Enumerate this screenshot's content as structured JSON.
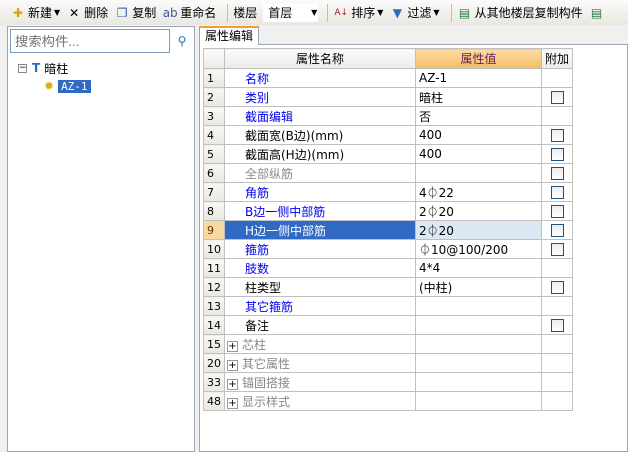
{
  "toolbar": {
    "new": "新建",
    "delete": "删除",
    "copy": "复制",
    "rename": "重命名",
    "floor_label": "楼层",
    "floor_value": "首层",
    "sort": "排序",
    "filter": "过滤",
    "copy_from_floor": "从其他楼层复制构件"
  },
  "left": {
    "search_placeholder": "搜索构件...",
    "tree_root": "暗柱",
    "tree_child": "AZ-1"
  },
  "tab": "属性编辑",
  "table": {
    "headers": [
      "属性名称",
      "属性值",
      "附加"
    ],
    "rows": [
      {
        "n": "1",
        "name": "名称",
        "value": "AZ-1",
        "color": "blue",
        "cb": false
      },
      {
        "n": "2",
        "name": "类别",
        "value": "暗柱",
        "color": "blue",
        "cb": true
      },
      {
        "n": "3",
        "name": "截面编辑",
        "value": "否",
        "color": "blue",
        "cb": false
      },
      {
        "n": "4",
        "name": "截面宽(B边)(mm)",
        "value": "400",
        "color": "black",
        "cb": true
      },
      {
        "n": "5",
        "name": "截面高(H边)(mm)",
        "value": "400",
        "color": "black",
        "cb": true
      },
      {
        "n": "6",
        "name": "全部纵筋",
        "value": "",
        "color": "gray",
        "cb": true
      },
      {
        "n": "7",
        "name": "角筋",
        "value": "4⏀22",
        "color": "blue",
        "cb": true
      },
      {
        "n": "8",
        "name": "B边一侧中部筋",
        "value": "2⏀20",
        "color": "blue",
        "cb": true
      },
      {
        "n": "9",
        "name": "H边一侧中部筋",
        "value": "2⏀20",
        "color": "blue",
        "cb": true,
        "selected": true
      },
      {
        "n": "10",
        "name": "箍筋",
        "value": "⏀10@100/200",
        "color": "blue",
        "cb": true
      },
      {
        "n": "11",
        "name": "肢数",
        "value": "4*4",
        "color": "blue",
        "cb": false
      },
      {
        "n": "12",
        "name": "柱类型",
        "value": "(中柱)",
        "color": "black",
        "cb": true
      },
      {
        "n": "13",
        "name": "其它箍筋",
        "value": "",
        "color": "blue",
        "cb": false
      },
      {
        "n": "14",
        "name": "备注",
        "value": "",
        "color": "black",
        "cb": true
      },
      {
        "n": "15",
        "name": "芯柱",
        "value": "",
        "color": "gray",
        "group": true
      },
      {
        "n": "20",
        "name": "其它属性",
        "value": "",
        "color": "gray",
        "group": true
      },
      {
        "n": "33",
        "name": "锚固搭接",
        "value": "",
        "color": "gray",
        "group": true
      },
      {
        "n": "48",
        "name": "显示样式",
        "value": "",
        "color": "gray",
        "group": true
      }
    ]
  }
}
